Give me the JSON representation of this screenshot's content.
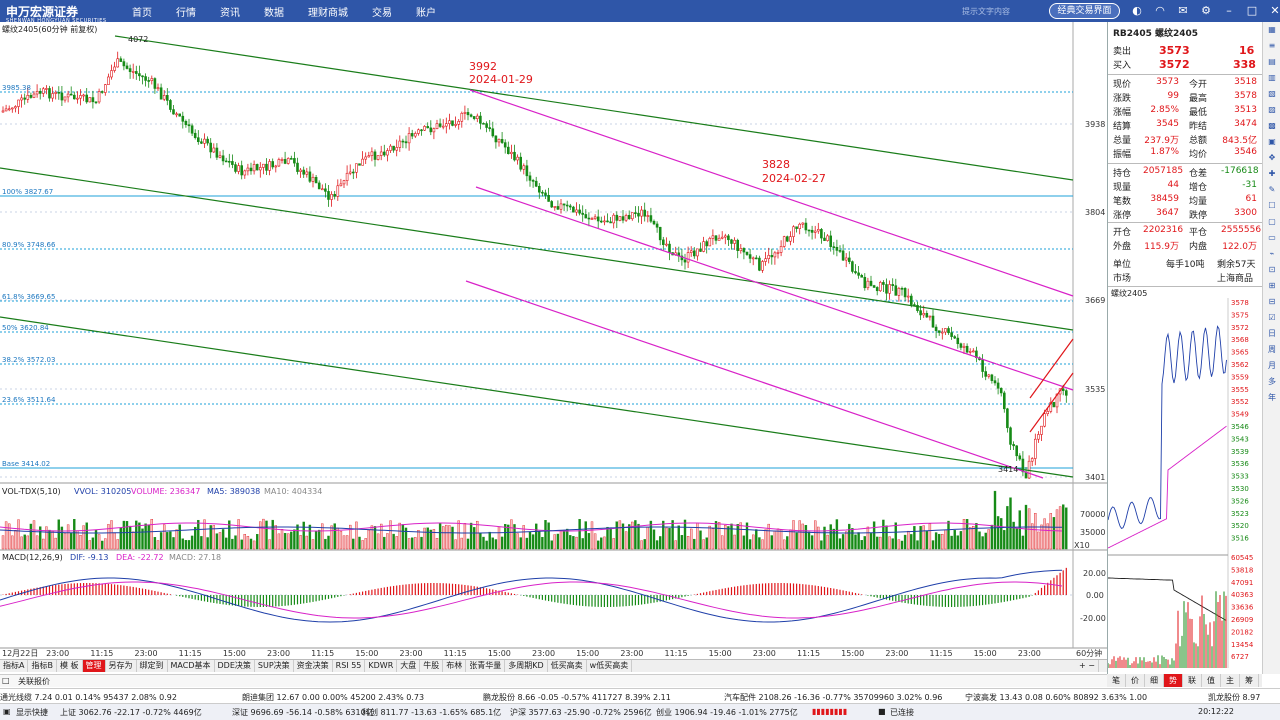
{
  "app": {
    "logo_text": "申万宏源证券",
    "logo_sub": "SHENWAN HONGYUAN SECURITIES",
    "nav": [
      "首页",
      "行情",
      "资讯",
      "数据",
      "理财商城",
      "交易",
      "账户"
    ],
    "top_right_text": "提示文字内容",
    "classic_button": "经典交易界面"
  },
  "chart": {
    "title": "螺纹2405(60分钟 前复权)",
    "price_labels": [
      "3938",
      "3804",
      "3669",
      "3535",
      "3401"
    ],
    "fib_labels": [
      "100% 3827.67",
      "80.9% 3748.66",
      "61.8% 3669.65",
      "50% 3620.84",
      "38.2% 3572.03",
      "23.6% 3511.64",
      "Base 3414.02"
    ],
    "fib_top_label": "3985.38",
    "peak_label": "4072",
    "low_label": "3414",
    "annotation1": {
      "price": "3992",
      "date": "2024-01-29"
    },
    "annotation2": {
      "price": "3828",
      "date": "2024-02-27"
    },
    "vol_title": "VOL-TDX(5,10)",
    "vol_label": "VVOL: 310205",
    "volume_label": "VOLUME: 236347",
    "ma5_label": "MA5: 389038",
    "ma10_label": "MA10: 404334",
    "vol_scale": [
      "70000",
      "35000",
      "X10"
    ],
    "macd_title": "MACD(12,26,9)",
    "macd_dif": "DIF: -9.13",
    "macd_dea": "DEA: -22.72",
    "macd_val": "MACD: 27.18",
    "macd_scale": [
      "20.00",
      "0.00",
      "-20.00"
    ],
    "x_labels": [
      "12月22日",
      "23:00",
      "11:15",
      "23:00",
      "11:15",
      "15:00",
      "23:00",
      "11:15",
      "15:00",
      "23:00",
      "11:15",
      "15:00",
      "23:00",
      "15:00",
      "23:00",
      "11:15",
      "15:00",
      "23:00",
      "11:15",
      "15:00",
      "23:00",
      "11:15",
      "15:00",
      "23:00"
    ],
    "period": "60分钟"
  },
  "quote": {
    "symbol": "RB2405 螺纹2405",
    "ask_label": "卖出",
    "ask_price": "3573",
    "ask_vol": "16",
    "bid_label": "买入",
    "bid_price": "3572",
    "bid_vol": "338",
    "rows": [
      [
        "现价",
        "3573",
        "今开",
        "3518"
      ],
      [
        "涨跌",
        "99",
        "最高",
        "3578"
      ],
      [
        "涨幅",
        "2.85%",
        "最低",
        "3513"
      ],
      [
        "结算",
        "3545",
        "昨结",
        "3474"
      ],
      [
        "总量",
        "237.9万",
        "总额",
        "843.5亿"
      ],
      [
        "振幅",
        "1.87%",
        "均价",
        "3546"
      ]
    ],
    "rows2": [
      [
        "持仓",
        "2057185",
        "仓差",
        "-176618"
      ],
      [
        "现量",
        "44",
        "增仓",
        "-31"
      ],
      [
        "笔数",
        "38459",
        "均量",
        "61"
      ],
      [
        "涨停",
        "3647",
        "跌停",
        "3300"
      ]
    ],
    "rows3": [
      [
        "开仓",
        "2202316",
        "平仓",
        "2555556"
      ],
      [
        "外盘",
        "115.9万",
        "内盘",
        "122.0万"
      ]
    ],
    "unit_label": "单位",
    "unit_value": "每手10吨",
    "remain": "剩余57天",
    "market_label": "市场",
    "market_value": "上海商品",
    "mini_title": "螺纹2405",
    "mini_prices": [
      "3578",
      "3575",
      "3572",
      "3568",
      "3565",
      "3562",
      "3559",
      "3555",
      "3552",
      "3549",
      "3546",
      "3543",
      "3539",
      "3536",
      "3533",
      "3530",
      "3526",
      "3523",
      "3520",
      "3516"
    ],
    "mini_vol": [
      "60545",
      "53818",
      "47091",
      "40363",
      "33636",
      "26909",
      "20182",
      "13454",
      "6727"
    ]
  },
  "bottom_tabs": [
    "指标A",
    "指标B",
    "模 板",
    "管理",
    "另存为",
    "绑定到",
    "MACD基本",
    "DDE决策",
    "SUP决策",
    "资金决策",
    "RSI 55",
    "KDWR",
    "大盘",
    "牛股",
    "布林",
    "张青华量",
    "多周期KD",
    "低买高卖",
    "w低买高卖"
  ],
  "sub_tabs": [
    "笔",
    "价",
    "细",
    "势",
    "联",
    "值",
    "主",
    "筹"
  ],
  "relate_label": "关联报价",
  "ticker": [
    "通光线缆  7.24  0.01  0.14%  95437  2.08%  0.92",
    "朗迪集团  12.67  0.00  0.00%  45200  2.43%  0.73",
    "鹏龙股份  8.66  -0.05  -0.57%  411727  8.39%  2.11",
    "汽车配件  2108.26  -16.36  -0.77%  35709960  3.02%  0.96",
    "宁波高发  13.43  0.08  0.60%  80892  3.63%  1.00",
    "凯龙股份  8.97"
  ],
  "status": {
    "display": "显示快捷",
    "sh": "上证 3062.76  -22.17  -0.72%  4469亿",
    "sz": "深证 9696.69  -56.14  -0.58%  6310亿",
    "kc": "科创 811.77  -13.63  -1.65%  685.1亿",
    "hs": "沪深 3577.63  -25.90  -0.72%  2596亿",
    "cy": "创业 1906.94  -19.46  -1.01%  2775亿",
    "conn": "已连接",
    "time": "20:12:22"
  }
}
